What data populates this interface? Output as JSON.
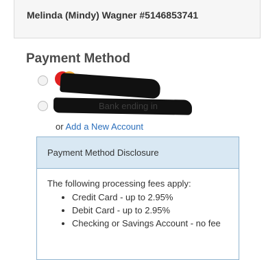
{
  "account": {
    "name": "Melinda (Mindy) Wagner #5146853741"
  },
  "payment_method": {
    "title": "Payment Method",
    "options": [
      {
        "label": "",
        "type": "card",
        "selected": false
      },
      {
        "label": "Bank ending in",
        "type": "bank",
        "selected": false
      }
    ],
    "add_account_prefix": "or",
    "add_account_link": "Add a New Account"
  },
  "disclosure": {
    "title": "Payment Method Disclosure",
    "intro": "The following processing fees apply:",
    "fees": [
      "Credit Card - up to 2.95%",
      "Debit Card - up to 2.95%",
      "Checking or Savings Account - no fee"
    ]
  },
  "colors": {
    "link": "#2a6ebb",
    "disclosure_header_bg": "#d9e8f3",
    "disclosure_border": "#8fb4d0",
    "card_red": "#e02020",
    "card_orange": "#f0a01e"
  },
  "icons": {
    "card": "credit-card-brand-icon"
  }
}
